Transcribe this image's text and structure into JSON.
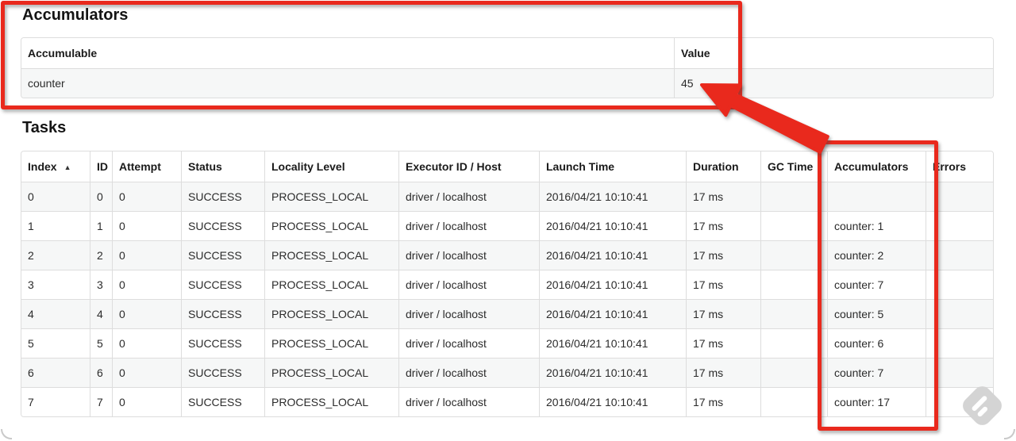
{
  "colors": {
    "annotation_red": "#e9291d",
    "row_stripe": "#f6f7f7",
    "table_border": "#dddddd",
    "watermark_gray": "#d4d4d4"
  },
  "accumulators": {
    "title": "Accumulators",
    "headers": {
      "accumulable": "Accumulable",
      "value": "Value"
    },
    "rows": [
      {
        "accumulable": "counter",
        "value": "45"
      }
    ]
  },
  "tasks": {
    "title": "Tasks",
    "sort_indicator": "▲",
    "headers": {
      "index": "Index",
      "id": "ID",
      "attempt": "Attempt",
      "status": "Status",
      "locality_level": "Locality Level",
      "executor_id_host": "Executor ID / Host",
      "launch_time": "Launch Time",
      "duration": "Duration",
      "gc_time": "GC Time",
      "accumulators": "Accumulators",
      "errors": "Errors"
    },
    "rows": [
      {
        "index": "0",
        "id": "0",
        "attempt": "0",
        "status": "SUCCESS",
        "locality_level": "PROCESS_LOCAL",
        "executor_id_host": "driver / localhost",
        "launch_time": "2016/04/21 10:10:41",
        "duration": "17 ms",
        "gc_time": "",
        "accumulators": "",
        "errors": ""
      },
      {
        "index": "1",
        "id": "1",
        "attempt": "0",
        "status": "SUCCESS",
        "locality_level": "PROCESS_LOCAL",
        "executor_id_host": "driver / localhost",
        "launch_time": "2016/04/21 10:10:41",
        "duration": "17 ms",
        "gc_time": "",
        "accumulators": "counter: 1",
        "errors": ""
      },
      {
        "index": "2",
        "id": "2",
        "attempt": "0",
        "status": "SUCCESS",
        "locality_level": "PROCESS_LOCAL",
        "executor_id_host": "driver / localhost",
        "launch_time": "2016/04/21 10:10:41",
        "duration": "17 ms",
        "gc_time": "",
        "accumulators": "counter: 2",
        "errors": ""
      },
      {
        "index": "3",
        "id": "3",
        "attempt": "0",
        "status": "SUCCESS",
        "locality_level": "PROCESS_LOCAL",
        "executor_id_host": "driver / localhost",
        "launch_time": "2016/04/21 10:10:41",
        "duration": "17 ms",
        "gc_time": "",
        "accumulators": "counter: 7",
        "errors": ""
      },
      {
        "index": "4",
        "id": "4",
        "attempt": "0",
        "status": "SUCCESS",
        "locality_level": "PROCESS_LOCAL",
        "executor_id_host": "driver / localhost",
        "launch_time": "2016/04/21 10:10:41",
        "duration": "17 ms",
        "gc_time": "",
        "accumulators": "counter: 5",
        "errors": ""
      },
      {
        "index": "5",
        "id": "5",
        "attempt": "0",
        "status": "SUCCESS",
        "locality_level": "PROCESS_LOCAL",
        "executor_id_host": "driver / localhost",
        "launch_time": "2016/04/21 10:10:41",
        "duration": "17 ms",
        "gc_time": "",
        "accumulators": "counter: 6",
        "errors": ""
      },
      {
        "index": "6",
        "id": "6",
        "attempt": "0",
        "status": "SUCCESS",
        "locality_level": "PROCESS_LOCAL",
        "executor_id_host": "driver / localhost",
        "launch_time": "2016/04/21 10:10:41",
        "duration": "17 ms",
        "gc_time": "",
        "accumulators": "counter: 7",
        "errors": ""
      },
      {
        "index": "7",
        "id": "7",
        "attempt": "0",
        "status": "SUCCESS",
        "locality_level": "PROCESS_LOCAL",
        "executor_id_host": "driver / localhost",
        "launch_time": "2016/04/21 10:10:41",
        "duration": "17 ms",
        "gc_time": "",
        "accumulators": "counter: 17",
        "errors": ""
      }
    ]
  }
}
